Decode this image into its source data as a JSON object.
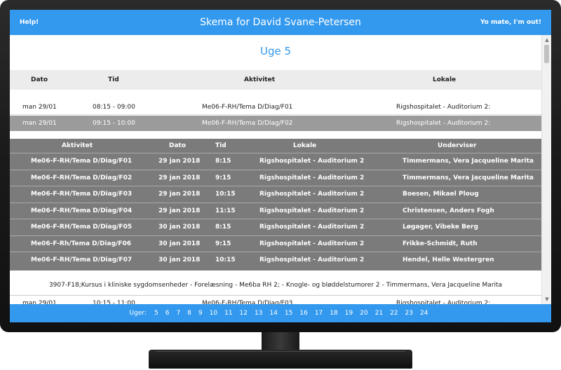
{
  "header": {
    "help": "Help!",
    "title": "Skema for David Svane-Petersen",
    "logout": "Yo mate, I'm out!"
  },
  "week_title": "Uge 5",
  "schedule": {
    "columns": [
      "Dato",
      "Tid",
      "Aktivitet",
      "Lokale"
    ],
    "rows": [
      {
        "date": "man 29/01",
        "time": "08:15 - 09:00",
        "activity": "Me06-F-RH/Tema D/Diag/F01",
        "location": "Rigshospitalet - Auditorium 2:"
      },
      {
        "date": "man 29/01",
        "time": "09:15 - 10:00",
        "activity": "Me06-F-RH/Tema D/Diag/F02",
        "location": "Rigshospitalet - Auditorium 2:"
      },
      {
        "date": "man 29/01",
        "time": "10:15 - 11:00",
        "activity": "Me06-F-RH/Tema D/Diag/F03",
        "location": "Rigshospitalet - Auditorium 2:"
      }
    ]
  },
  "details": {
    "columns": [
      "Aktivitet",
      "Dato",
      "Tid",
      "Lokale",
      "Underviser"
    ],
    "rows": [
      {
        "activity": "Me06-F-RH/Tema D/Diag/F01",
        "date": "29 jan 2018",
        "time": "8:15",
        "location": "Rigshospitalet - Auditorium 2",
        "teacher": "Timmermans, Vera Jacqueline Marita"
      },
      {
        "activity": "Me06-F-RH/Tema D/Diag/F02",
        "date": "29 jan 2018",
        "time": "9:15",
        "location": "Rigshospitalet - Auditorium 2",
        "teacher": "Timmermans, Vera Jacqueline Marita"
      },
      {
        "activity": "Me06-F-RH/Tema D/Diag/F03",
        "date": "29 jan 2018",
        "time": "10:15",
        "location": "Rigshospitalet - Auditorium 2",
        "teacher": "Boesen, Mikael Ploug"
      },
      {
        "activity": "Me06-F-RH/Tema D/Diag/F04",
        "date": "29 jan 2018",
        "time": "11:15",
        "location": "Rigshospitalet - Auditorium 2",
        "teacher": "Christensen, Anders Fogh"
      },
      {
        "activity": "Me06-F-RH/Tema D/Diag/F05",
        "date": "30 jan 2018",
        "time": "8:15",
        "location": "Rigshospitalet - Auditorium 2",
        "teacher": "Løgager, Vibeke Berg"
      },
      {
        "activity": "Me06-F-Rh/Tema D/Diag/F06",
        "date": "30 jan 2018",
        "time": "9:15",
        "location": "Rigshospitalet - Auditorium 2",
        "teacher": "Frikke-Schmidt, Ruth"
      },
      {
        "activity": "Me06-F-RH/Tema D/Diag/F07",
        "date": "30 jan 2018",
        "time": "10:15",
        "location": "Rigshospitalet - Auditorium 2",
        "teacher": "Hendel, Helle Westergren"
      }
    ]
  },
  "note": "3907-F18;Kursus i kliniske sygdomsenheder - Forelæsning - Me6ba RH 2; - Knogle- og bløddelstumorer 2 - Timmermans, Vera Jacqueline Marita",
  "footer": {
    "label": "Uger:",
    "weeks": [
      "5",
      "6",
      "7",
      "8",
      "9",
      "10",
      "11",
      "12",
      "13",
      "14",
      "15",
      "16",
      "17",
      "18",
      "19",
      "20",
      "21",
      "22",
      "23",
      "24"
    ]
  },
  "colors": {
    "accent": "#3399ee",
    "selected_row": "#9b9b9b",
    "detail_bg": "#7b7b7b"
  },
  "icons": {
    "scroll_up": "triangle-up",
    "scroll_down": "triangle-down"
  }
}
